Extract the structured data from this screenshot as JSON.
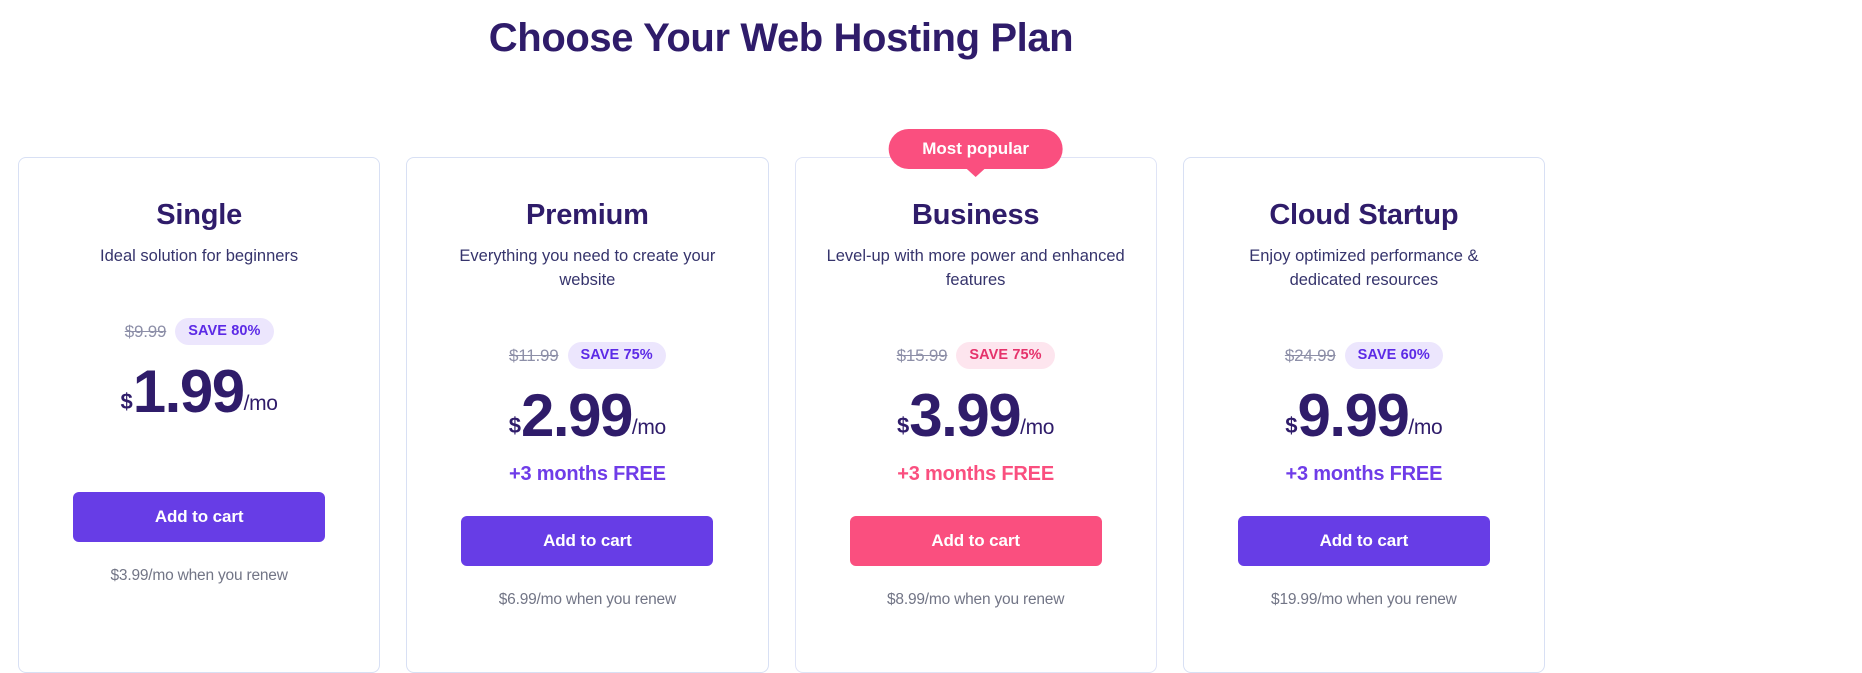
{
  "header": {
    "title": "Choose Your Web Hosting Plan"
  },
  "colors": {
    "title_purple": "#2f1c6a",
    "accent_purple": "#673de6",
    "accent_pink": "#fa4f7f",
    "save_badge_purple_bg": "#ece6fd",
    "save_badge_purple_text": "#5c2ae6",
    "save_badge_pink_bg": "#fde5ee",
    "save_badge_pink_text": "#e5326b",
    "card_border": "#d8e0f4",
    "description_text": "#36346c",
    "renew_text": "#727586",
    "old_price_text": "#8d8fa8"
  },
  "plans": [
    {
      "name": "Single",
      "description": "Ideal solution for beginners",
      "old_price": "$9.99",
      "save_label": "SAVE 80%",
      "save_style": "purple",
      "currency": "$",
      "amount": "1.99",
      "period": "/mo",
      "free_months": "",
      "free_months_style": "empty",
      "cta_label": "Add to cart",
      "cta_style": "purple",
      "renew_note": "$3.99/mo when you renew",
      "badge": null
    },
    {
      "name": "Premium",
      "description": "Everything you need to create your website",
      "old_price": "$11.99",
      "save_label": "SAVE 75%",
      "save_style": "purple",
      "currency": "$",
      "amount": "2.99",
      "period": "/mo",
      "free_months": "+3 months FREE",
      "free_months_style": "purple",
      "cta_label": "Add to cart",
      "cta_style": "purple",
      "renew_note": "$6.99/mo when you renew",
      "badge": null
    },
    {
      "name": "Business",
      "description": "Level-up with more power and enhanced features",
      "old_price": "$15.99",
      "save_label": "SAVE 75%",
      "save_style": "pink",
      "currency": "$",
      "amount": "3.99",
      "period": "/mo",
      "free_months": "+3 months FREE",
      "free_months_style": "pink",
      "cta_label": "Add to cart",
      "cta_style": "pink",
      "renew_note": "$8.99/mo when you renew",
      "badge": "Most popular"
    },
    {
      "name": "Cloud Startup",
      "description": "Enjoy optimized performance & dedicated resources",
      "old_price": "$24.99",
      "save_label": "SAVE 60%",
      "save_style": "purple",
      "currency": "$",
      "amount": "9.99",
      "period": "/mo",
      "free_months": "+3 months FREE",
      "free_months_style": "purple",
      "cta_label": "Add to cart",
      "cta_style": "purple",
      "renew_note": "$19.99/mo when you renew",
      "badge": null
    }
  ]
}
